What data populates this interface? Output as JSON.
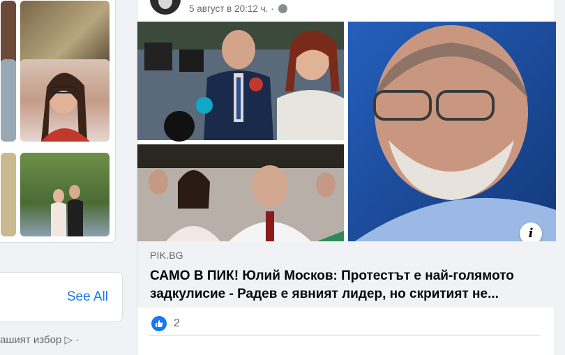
{
  "sidebar": {
    "see_all_label": "See All",
    "ad_choice_text": "ашият избор ▷ ·"
  },
  "post": {
    "timestamp": "5 август в 20:12 ч. ·",
    "privacy_icon": "globe-icon",
    "link": {
      "domain": "PIK.BG",
      "title": "САМО В ПИК! Юлий Москов: Протестът е най-голямото задкулисие - Радев е явният лидер, но скритият не...",
      "info_label": "i"
    },
    "reactions": {
      "icon": "like-icon",
      "count": "2"
    }
  },
  "colors": {
    "accent": "#1877f2",
    "background": "#f0f2f5",
    "card": "#ffffff"
  }
}
